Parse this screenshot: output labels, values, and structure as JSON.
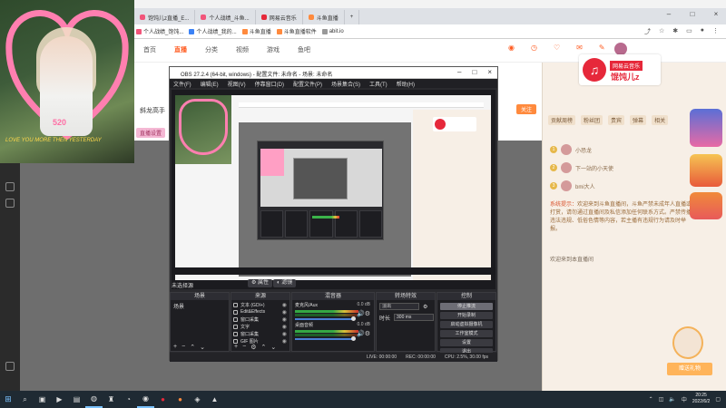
{
  "browser": {
    "tabs": [
      {
        "label": "饱饨儿z直播_E..."
      },
      {
        "label": "个人战绩_斗鱼..."
      },
      {
        "label": "网易云音乐"
      },
      {
        "label": "斗鱼直播"
      }
    ],
    "bookmarks": [
      {
        "label": "个人战绩_饱饨..."
      },
      {
        "label": "个人战绩_我的..."
      },
      {
        "label": "斗鱼直播"
      },
      {
        "label": "斗鱼直播软件"
      },
      {
        "label": "abit.io"
      }
    ]
  },
  "site": {
    "nav": [
      "首页",
      "直播",
      "分类",
      "视频",
      "游戏",
      "鱼吧"
    ],
    "nav_active": "直播",
    "room_title": "斜龙高手",
    "room_tag": "直播设置"
  },
  "netease": {
    "title": "网易云音乐",
    "name": "馄饨儿z"
  },
  "webcam": {
    "caption": "LOVE YOU MORE THEN YESTERDAY",
    "number": "520"
  },
  "right_panel": {
    "tabs": [
      "贡献周榜",
      "粉丝团",
      "贵宾",
      "弹幕",
      "相关"
    ],
    "follow_label": "关注",
    "ranks": [
      {
        "rank": "1",
        "name": "小恐龙"
      },
      {
        "rank": "2",
        "name": "下一站的小天使"
      },
      {
        "rank": "3",
        "name": "bmi大人"
      }
    ],
    "chat_lead": "系统提示：",
    "chat_body": "欢迎来到斗鱼直播间，斗鱼严禁未成年人直播或打赏，请勿通过直播间及私信添加任何联系方式。严禁传播违法违规、低俗色情等内容，若主播有违规行为请及时举报。",
    "chat_join": "欢迎来到本直播间",
    "gift_button": "赠送礼物"
  },
  "obs": {
    "title": "OBS 27.2.4 (64-bit, windows) - 配置文件: 未命名 - 场景: 未命名",
    "menu": [
      "文件(F)",
      "编辑(E)",
      "视图(V)",
      "停靠窗口(D)",
      "配置文件(P)",
      "场景集合(S)",
      "工具(T)",
      "帮助(H)"
    ],
    "scene_filter_label": "未选择源",
    "props_label": "属性",
    "filters_label": "滤镜",
    "docks": {
      "scenes": "场景",
      "sources": "来源",
      "mixer": "混音器",
      "transitions": "转场特效",
      "controls": "控制"
    },
    "scenes": [
      "场景"
    ],
    "sources": [
      "文本 (GDI+)",
      "Edit&Effects",
      "窗口采集",
      "文字",
      "窗口采集",
      "GIF 图片"
    ],
    "mixer": [
      {
        "name": "麦克风/Aux",
        "db": "0.0 dB"
      },
      {
        "name": "桌面音频",
        "db": "0.0 dB"
      }
    ],
    "transition": {
      "type": "淡出",
      "duration_label": "时长",
      "duration": "300 ms"
    },
    "controls": [
      "停止推流",
      "开始录制",
      "启动虚拟摄像机",
      "工作室模式",
      "设置",
      "退出"
    ],
    "status": {
      "live": "LIVE: 00:00:00",
      "rec": "REC: 00:00:00",
      "cpu": "CPU: 2.5%, 30.00 fps"
    }
  },
  "taskbar": {
    "time": "20:25",
    "date": "2022/6/2",
    "lang": "中"
  },
  "colors": {
    "douyu_orange": "#ff5d23",
    "netease_red": "#e6283a",
    "obs_dark": "#2a2a2e",
    "panel_cream": "#f7efe6"
  }
}
